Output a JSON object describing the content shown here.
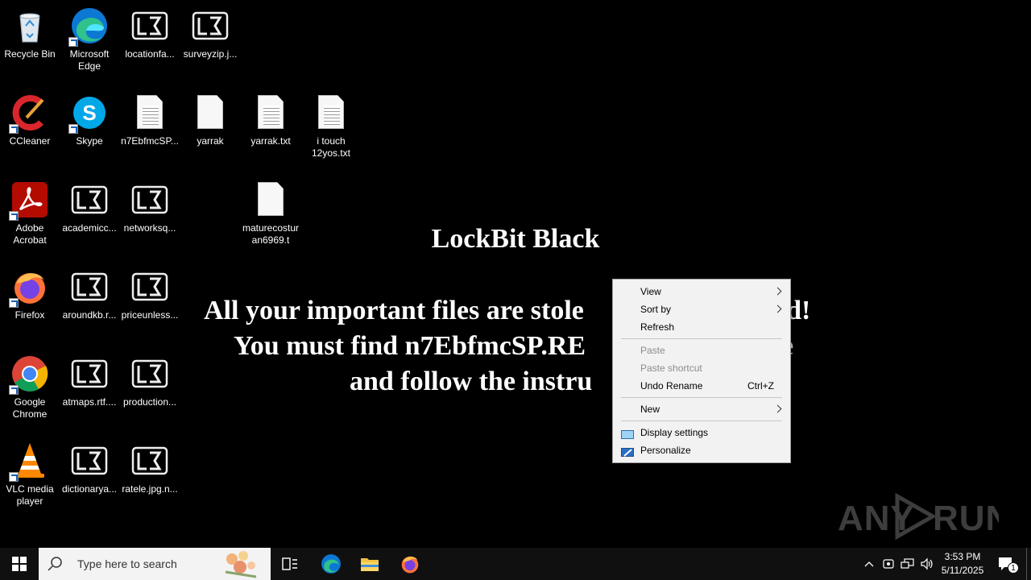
{
  "desktop": {
    "icons": [
      {
        "label": "Recycle Bin",
        "icon": "recycle-bin-icon"
      },
      {
        "label": "Microsoft Edge",
        "icon": "edge-icon"
      },
      {
        "label": "locationfa...",
        "icon": "lockbit-file-icon"
      },
      {
        "label": "surveyzip.j...",
        "icon": "lockbit-file-icon"
      },
      {
        "label": "CCleaner",
        "icon": "ccleaner-icon"
      },
      {
        "label": "Skype",
        "icon": "skype-icon"
      },
      {
        "label": "n7EbfmcSP...",
        "icon": "text-file-icon"
      },
      {
        "label": "yarrak",
        "icon": "blank-file-icon"
      },
      {
        "label": "yarrak.txt",
        "icon": "text-file-icon"
      },
      {
        "label": "i touch 12yos.txt",
        "icon": "text-file-icon"
      },
      {
        "label": "Adobe Acrobat",
        "icon": "acrobat-icon"
      },
      {
        "label": "academicc...",
        "icon": "lockbit-file-icon"
      },
      {
        "label": "networksq...",
        "icon": "lockbit-file-icon"
      },
      {
        "label": "maturecostur an6969.t",
        "icon": "blank-file-icon"
      },
      {
        "label": "Firefox",
        "icon": "firefox-icon"
      },
      {
        "label": "aroundkb.r...",
        "icon": "lockbit-file-icon"
      },
      {
        "label": "priceunless...",
        "icon": "lockbit-file-icon"
      },
      {
        "label": "Google Chrome",
        "icon": "chrome-icon"
      },
      {
        "label": "atmaps.rtf....",
        "icon": "lockbit-file-icon"
      },
      {
        "label": "production...",
        "icon": "lockbit-file-icon"
      },
      {
        "label": "VLC media player",
        "icon": "vlc-icon"
      },
      {
        "label": "dictionarya...",
        "icon": "lockbit-file-icon"
      },
      {
        "label": "ratele.jpg.n...",
        "icon": "lockbit-file-icon"
      }
    ]
  },
  "wallpaper": {
    "title": "LockBit Black",
    "line1": "All your important files are stole",
    "line1_tail": "ed!",
    "line2": "You must find n7EbfmcSP.RE",
    "line2_tail": "e",
    "line3": "and follow the instru"
  },
  "context_menu": {
    "items": [
      {
        "label": "View",
        "submenu": true
      },
      {
        "label": "Sort by",
        "submenu": true
      },
      {
        "label": "Refresh"
      },
      {
        "label": "Paste",
        "disabled": true
      },
      {
        "label": "Paste shortcut",
        "disabled": true
      },
      {
        "label": "Undo Rename",
        "shortcut": "Ctrl+Z"
      },
      {
        "label": "New",
        "submenu": true
      },
      {
        "label": "Display settings",
        "icon": "display-settings-icon"
      },
      {
        "label": "Personalize",
        "icon": "personalize-icon"
      }
    ]
  },
  "watermark": {
    "text": "ANY RUN"
  },
  "taskbar": {
    "search_placeholder": "Type here to search",
    "clock_time": "3:53 PM",
    "clock_date": "5/11/2025",
    "notification_count": "1"
  },
  "colors": {
    "background": "#000000",
    "taskbar": "#101010",
    "menu": "#f2f2f2"
  }
}
